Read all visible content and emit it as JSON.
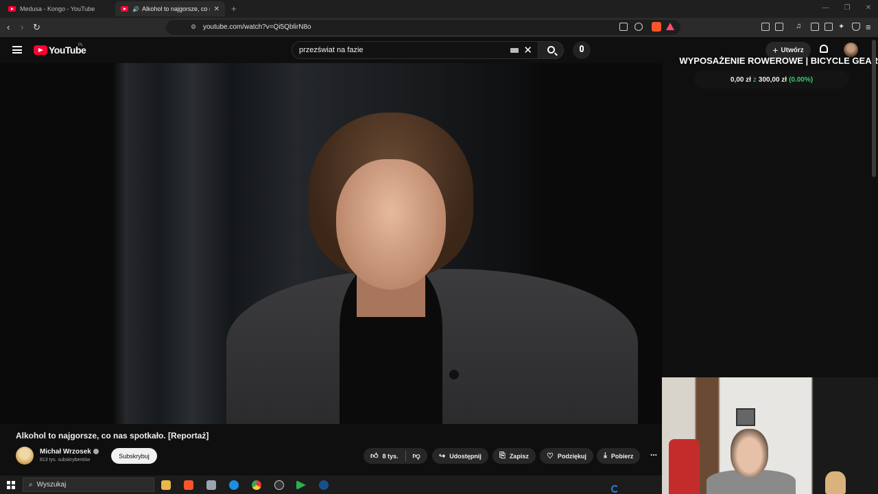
{
  "browser": {
    "tabs": [
      {
        "title": "Medusa - Kongo - YouTube",
        "active": false
      },
      {
        "title": "Alkohol to najgorsze, co nas s",
        "active": true
      }
    ],
    "url": "youtube.com/watch?v=Qi5QblirN8o"
  },
  "youtube": {
    "logo_text": "YouTube",
    "logo_region": "PL",
    "search_value": "przezświat na fazie",
    "create_label": "Utwórz"
  },
  "overlay": {
    "goal_title": "WYPOSAŻENIE ROWEROWE | BICYCLE GEAR",
    "goal_current": "0,00 zł",
    "goal_sep": "z",
    "goal_target": "300,00 zł",
    "goal_percent": "(0.00%)",
    "goal_progress": 0
  },
  "video": {
    "title": "Alkohol to najgorsze, co nas spotkało. [Reportaż]",
    "channel": "Michał Wrzosek",
    "subscribers": "813 tys. subskrybentów",
    "subscribe_label": "Subskrybuj",
    "likes": "8 tys.",
    "share_label": "Udostępnij",
    "save_label": "Zapisz",
    "thanks_label": "Podziękuj",
    "download_label": "Pobierz",
    "more_label": "..."
  },
  "taskbar": {
    "search_placeholder": "Wyszukaj"
  },
  "colors": {
    "brand_red": "#ff0033",
    "goal_green": "#35d06a",
    "background": "#0f0f0f"
  }
}
